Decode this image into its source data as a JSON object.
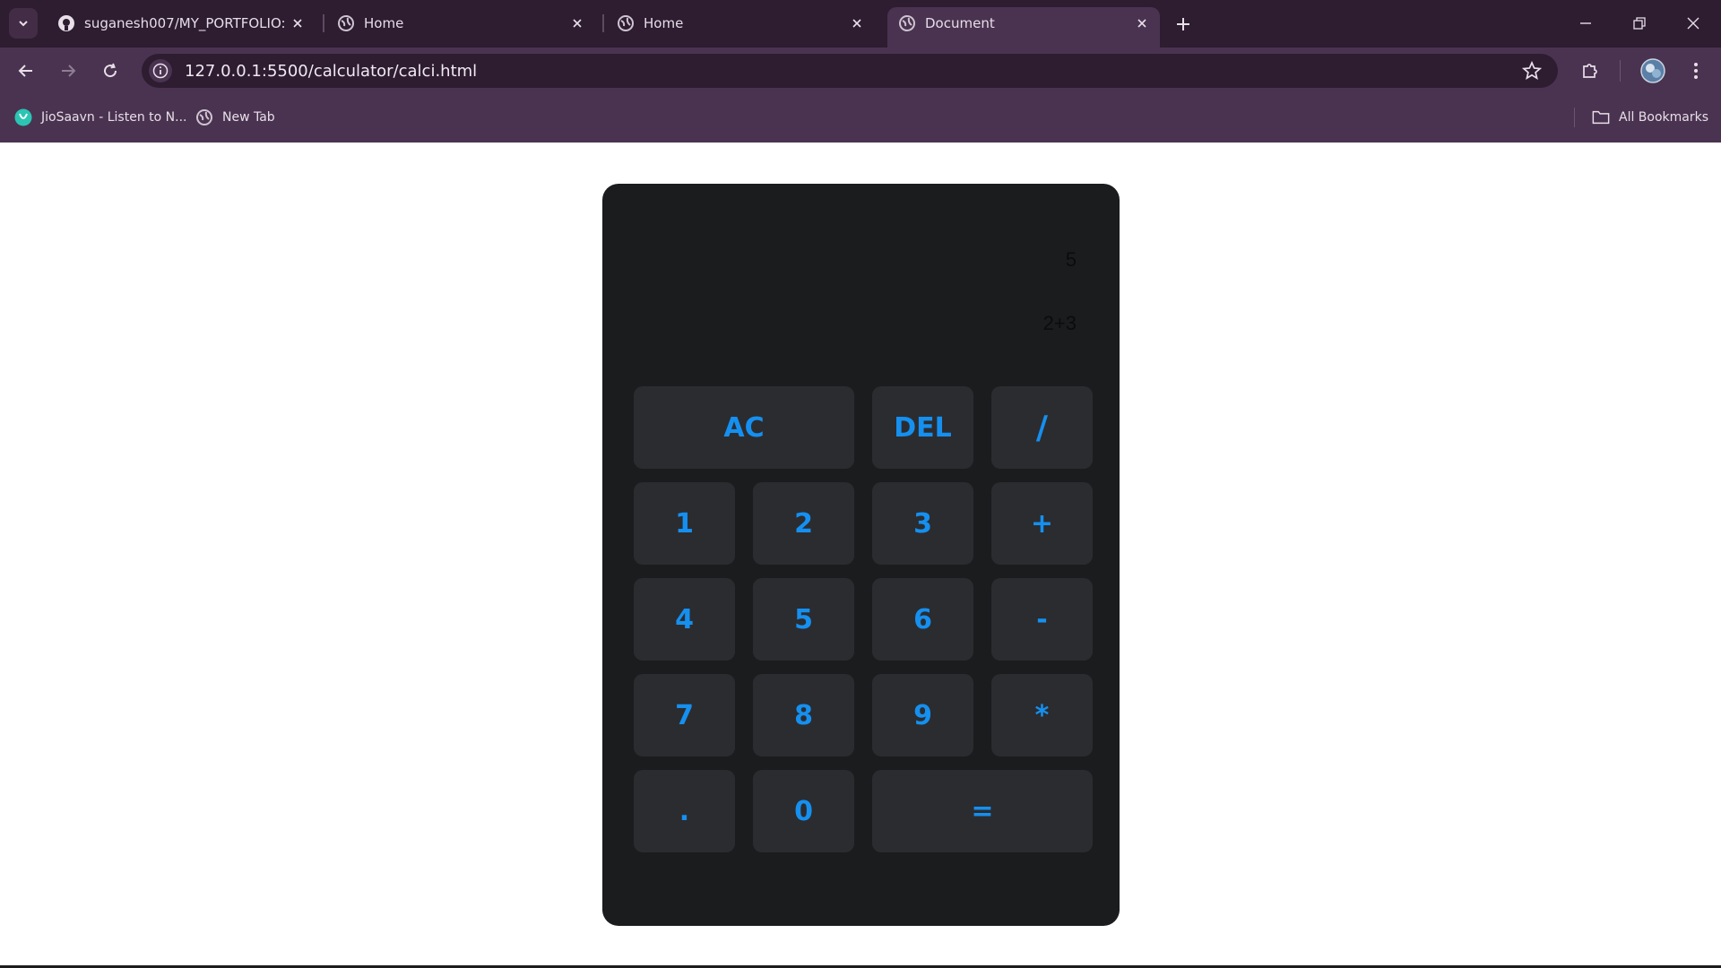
{
  "tabs": [
    {
      "title": "suganesh007/MY_PORTFOLIO: 💻",
      "favicon": "github-icon",
      "active": false
    },
    {
      "title": "Home",
      "favicon": "globe-icon",
      "active": false
    },
    {
      "title": "Home",
      "favicon": "globe-icon",
      "active": false
    },
    {
      "title": "Document",
      "favicon": "globe-icon",
      "active": true
    }
  ],
  "address_bar": {
    "url": "127.0.0.1:5500/calculator/calci.html"
  },
  "bookmarks": [
    {
      "label": "JioSaavn - Listen to N...",
      "icon": "jiosaavn-icon"
    },
    {
      "label": "New Tab",
      "icon": "globe-icon"
    }
  ],
  "all_bookmarks_label": "All Bookmarks",
  "calculator": {
    "previous_operand": "5",
    "current_operand": "2+3",
    "keys": {
      "ac": "AC",
      "del": "DEL",
      "divide": "/",
      "one": "1",
      "two": "2",
      "three": "3",
      "plus": "+",
      "four": "4",
      "five": "5",
      "six": "6",
      "minus": "-",
      "seven": "7",
      "eight": "8",
      "nine": "9",
      "multiply": "*",
      "dot": ".",
      "zero": "0",
      "equals": "="
    }
  },
  "colors": {
    "accent": "#1590f0",
    "calc_body": "#1b1c1e",
    "key_bg": "#2b2c30",
    "titlebar": "#2e1c31",
    "toolbar": "#4a3350"
  }
}
